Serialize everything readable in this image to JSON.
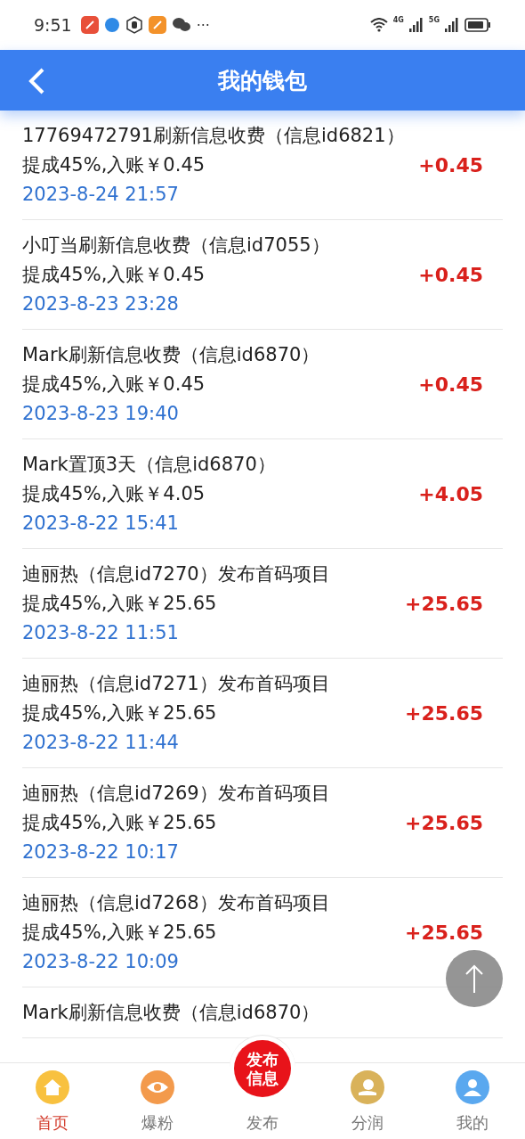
{
  "status_bar": {
    "time": "9:51",
    "more": "···",
    "network_labels": [
      "4G",
      "5G"
    ]
  },
  "header": {
    "title": "我的钱包"
  },
  "records": [
    {
      "title": "17769472791刷新信息收费（信息id6821）",
      "detail": "提成45%,入账￥0.45",
      "date": "2023-8-24 21:57",
      "amount": "+0.45"
    },
    {
      "title": "小叮当刷新信息收费（信息id7055）",
      "detail": "提成45%,入账￥0.45",
      "date": "2023-8-23 23:28",
      "amount": "+0.45"
    },
    {
      "title": "Mark刷新信息收费（信息id6870）",
      "detail": "提成45%,入账￥0.45",
      "date": "2023-8-23 19:40",
      "amount": "+0.45"
    },
    {
      "title": "Mark置顶3天（信息id6870）",
      "detail": "提成45%,入账￥4.05",
      "date": "2023-8-22 15:41",
      "amount": "+4.05"
    },
    {
      "title": "迪丽热（信息id7270）发布首码项目",
      "detail": "提成45%,入账￥25.65",
      "date": "2023-8-22 11:51",
      "amount": "+25.65"
    },
    {
      "title": "迪丽热（信息id7271）发布首码项目",
      "detail": "提成45%,入账￥25.65",
      "date": "2023-8-22 11:44",
      "amount": "+25.65"
    },
    {
      "title": "迪丽热（信息id7269）发布首码项目",
      "detail": "提成45%,入账￥25.65",
      "date": "2023-8-22 10:17",
      "amount": "+25.65"
    },
    {
      "title": "迪丽热（信息id7268）发布首码项目",
      "detail": "提成45%,入账￥25.65",
      "date": "2023-8-22 10:09",
      "amount": "+25.65"
    },
    {
      "title": "Mark刷新信息收费（信息id6870）"
    }
  ],
  "bottom_nav": [
    {
      "kind": "tab",
      "label": "首页",
      "selected": true,
      "color": "#f8c13f"
    },
    {
      "kind": "tab",
      "label": "爆粉",
      "selected": false,
      "color": "#f39a4c"
    },
    {
      "kind": "publish",
      "label": "发布",
      "button_lines": [
        "发布",
        "信息"
      ],
      "selected": false
    },
    {
      "kind": "tab",
      "label": "分润",
      "selected": false,
      "color": "#d9b25a"
    },
    {
      "kind": "tab",
      "label": "我的",
      "selected": false,
      "color": "#5aa8ef"
    }
  ]
}
